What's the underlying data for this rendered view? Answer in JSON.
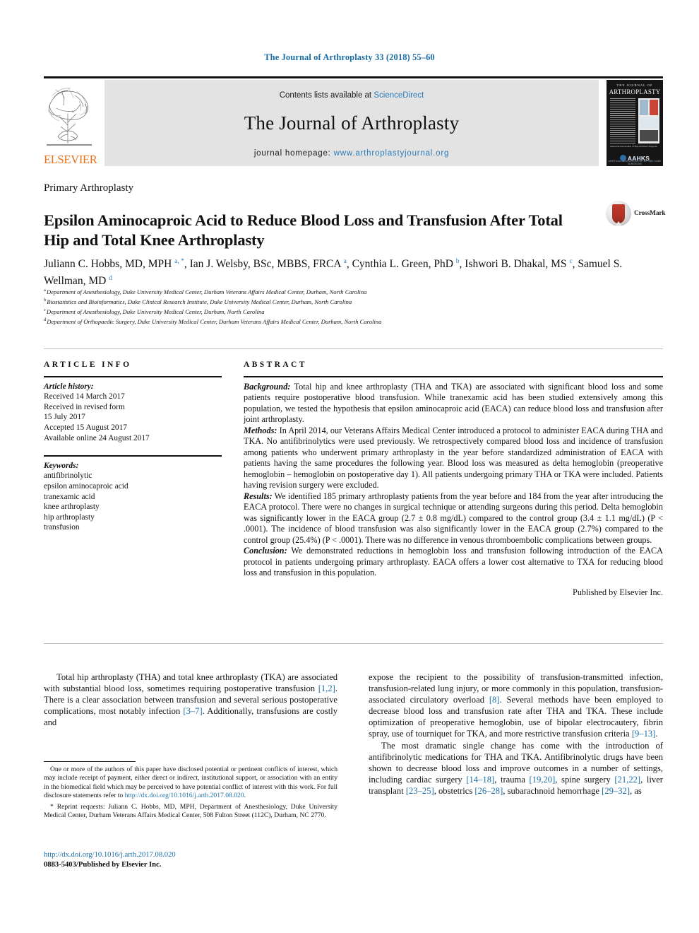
{
  "running_head": "The Journal of Arthroplasty 33 (2018) 55–60",
  "masthead": {
    "contents_prefix": "Contents lists available at ",
    "contents_link": "ScienceDirect",
    "journal_title": "The Journal of Arthroplasty",
    "homepage_prefix": "journal homepage: ",
    "homepage_url": "www.arthroplastyjournal.org",
    "publisher_logo_text": "ELSEVIER",
    "cover": {
      "top_line": "THE JOURNAL OF",
      "name": "ARTHROPLASTY",
      "caption": "American Association of Hip and Knee Surgeons",
      "society": "AAHKS",
      "society_sub": "AMERICAN ASSOCIATION OF HIP AND KNEE SURGEONS"
    }
  },
  "section_label": "Primary Arthroplasty",
  "title": "Epsilon Aminocaproic Acid to Reduce Blood Loss and Transfusion After Total Hip and Total Knee Arthroplasty",
  "crossmark_label": "CrossMark",
  "authors": [
    {
      "name": "Juliann C. Hobbs, MD, MPH",
      "marks": "a, *",
      "sep": ", "
    },
    {
      "name": "Ian J. Welsby, BSc, MBBS, FRCA",
      "marks": "a",
      "sep": ", "
    },
    {
      "name": "Cynthia L. Green, PhD",
      "marks": "b",
      "sep": ", "
    },
    {
      "name": "Ishwori B. Dhakal, MS",
      "marks": "c",
      "sep": ", "
    },
    {
      "name": "Samuel S. Wellman, MD",
      "marks": "d",
      "sep": ""
    }
  ],
  "affiliations": [
    {
      "mark": "a",
      "text": "Department of Anesthesiology, Duke University Medical Center, Durham Veterans Affairs Medical Center, Durham, North Carolina"
    },
    {
      "mark": "b",
      "text": "Biostatistics and Bioinformatics, Duke Clinical Research Institute, Duke University Medical Center, Durham, North Carolina"
    },
    {
      "mark": "c",
      "text": "Department of Anesthesiology, Duke University Medical Center, Durham, North Carolina"
    },
    {
      "mark": "d",
      "text": "Department of Orthopaedic Surgery, Duke University Medical Center, Durham Veterans Affairs Medical Center, Durham, North Carolina"
    }
  ],
  "article_info": {
    "heading": "ARTICLE INFO",
    "history_label": "Article history:",
    "history": [
      "Received 14 March 2017",
      "Received in revised form",
      "15 July 2017",
      "Accepted 15 August 2017",
      "Available online 24 August 2017"
    ],
    "keywords_label": "Keywords:",
    "keywords": [
      "antifibrinolytic",
      "epsilon aminocaproic acid",
      "tranexamic acid",
      "knee arthroplasty",
      "hip arthroplasty",
      "transfusion"
    ]
  },
  "abstract": {
    "heading": "ABSTRACT",
    "sections": [
      {
        "lead": "Background:",
        "text": " Total hip and knee arthroplasty (THA and TKA) are associated with significant blood loss and some patients require postoperative blood transfusion. While tranexamic acid has been studied extensively among this population, we tested the hypothesis that epsilon aminocaproic acid (EACA) can reduce blood loss and transfusion after joint arthroplasty."
      },
      {
        "lead": "Methods:",
        "text": " In April 2014, our Veterans Affairs Medical Center introduced a protocol to administer EACA during THA and TKA. No antifibrinolytics were used previously. We retrospectively compared blood loss and incidence of transfusion among patients who underwent primary arthroplasty in the year before standardized administration of EACA with patients having the same procedures the following year. Blood loss was measured as delta hemoglobin (preoperative hemoglobin – hemoglobin on postoperative day 1). All patients undergoing primary THA or TKA were included. Patients having revision surgery were excluded."
      },
      {
        "lead": "Results:",
        "text": " We identified 185 primary arthroplasty patients from the year before and 184 from the year after introducing the EACA protocol. There were no changes in surgical technique or attending surgeons during this period. Delta hemoglobin was significantly lower in the EACA group (2.7 ± 0.8 mg/dL) compared to the control group (3.4 ± 1.1 mg/dL) (P < .0001). The incidence of blood transfusion was also significantly lower in the EACA group (2.7%) compared to the control group (25.4%) (P < .0001). There was no difference in venous thromboembolic complications between groups."
      },
      {
        "lead": "Conclusion:",
        "text": " We demonstrated reductions in hemoglobin loss and transfusion following introduction of the EACA protocol in patients undergoing primary arthroplasty. EACA offers a lower cost alternative to TXA for reducing blood loss and transfusion in this population."
      }
    ],
    "published_by": "Published by Elsevier Inc."
  },
  "body": {
    "left_paragraph_1_a": "Total hip arthroplasty (THA) and total knee arthroplasty (TKA) are associated with substantial blood loss, sometimes requiring postoperative transfusion ",
    "left_ref_1": "[1,2]",
    "left_paragraph_1_b": ". There is a clear association between transfusion and several serious postoperative complications, most notably infection ",
    "left_ref_2": "[3–7]",
    "left_paragraph_1_c": ". Additionally, transfusions are costly and",
    "right_paragraph_1_a": "expose the recipient to the possibility of transfusion-transmitted infection, transfusion-related lung injury, or more commonly in this population, transfusion-associated circulatory overload ",
    "right_ref_1": "[8]",
    "right_paragraph_1_b": ". Several methods have been employed to decrease blood loss and transfusion rate after THA and TKA. These include optimization of preoperative hemoglobin, use of bipolar electrocautery, fibrin spray, use of tourniquet for TKA, and more restrictive transfusion criteria ",
    "right_ref_2": "[9–13]",
    "right_paragraph_1_c": ".",
    "right_paragraph_2_a": "The most dramatic single change has come with the introduction of antifibrinolytic medications for THA and TKA. Antifibrinolytic drugs have been shown to decrease blood loss and improve outcomes in a number of settings, including cardiac surgery ",
    "right_ref_3": "[14–18]",
    "right_paragraph_2_b": ", trauma ",
    "right_ref_4": "[19,20]",
    "right_paragraph_2_c": ", spine surgery ",
    "right_ref_5": "[21,22]",
    "right_paragraph_2_d": ", liver transplant ",
    "right_ref_6": "[23–25]",
    "right_paragraph_2_e": ", obstetrics ",
    "right_ref_7": "[26–28]",
    "right_paragraph_2_f": ", subarachnoid hemorrhage ",
    "right_ref_8": "[29–32]",
    "right_paragraph_2_g": ", as"
  },
  "footnotes": {
    "disclosure_a": "One or more of the authors of this paper have disclosed potential or pertinent conflicts of interest, which may include receipt of payment, either direct or indirect, institutional support, or association with an entity in the biomedical field which may be perceived to have potential conflict of interest with this work. For full disclosure statements refer to ",
    "disclosure_link": "http://dx.doi.org/10.1016/j.arth.2017.08.020",
    "disclosure_b": ".",
    "reprint_marker": "* ",
    "reprint": "Reprint requests: Juliann C. Hobbs, MD, MPH, Department of Anesthesiology, Duke University Medical Center, Durham Veterans Affairs Medical Center, 508 Fulton Street (112C), Durham, NC 2770."
  },
  "footer": {
    "doi": "http://dx.doi.org/10.1016/j.arth.2017.08.020",
    "issn": "0883-5403/Published by Elsevier Inc."
  },
  "colors": {
    "link": "#1b6ea5",
    "masthead_bg": "#e3e3e3",
    "elsevier_orange": "#e8711a",
    "crossmark_red": "#c0392b"
  }
}
